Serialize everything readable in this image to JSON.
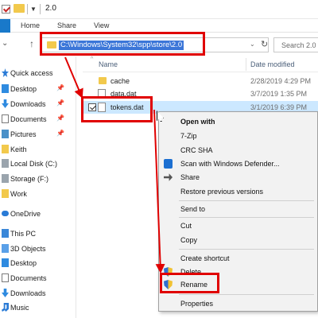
{
  "window": {
    "title": "2.0"
  },
  "ribbon": {
    "tabs": [
      "Home",
      "Share",
      "View"
    ]
  },
  "address": {
    "path": "C:\\Windows\\System32\\spp\\store\\2.0"
  },
  "search": {
    "placeholder": "Search 2.0"
  },
  "sidebar": {
    "items": [
      {
        "label": "Quick access",
        "icon": "star-icon"
      },
      {
        "label": "Desktop",
        "icon": "desktop-icon",
        "pinned": true
      },
      {
        "label": "Downloads",
        "icon": "downloads-icon",
        "pinned": true
      },
      {
        "label": "Documents",
        "icon": "documents-icon",
        "pinned": true
      },
      {
        "label": "Pictures",
        "icon": "pictures-icon",
        "pinned": true
      },
      {
        "label": "Keith",
        "icon": "folder-icon"
      },
      {
        "label": "Local Disk (C:)",
        "icon": "drive-icon"
      },
      {
        "label": "Storage (F:)",
        "icon": "drive-icon"
      },
      {
        "label": "Work",
        "icon": "folder-icon"
      },
      {
        "label": "OneDrive",
        "icon": "cloud-icon"
      },
      {
        "label": "This PC",
        "icon": "pc-icon"
      },
      {
        "label": "3D Objects",
        "icon": "3d-objects-icon"
      },
      {
        "label": "Desktop",
        "icon": "desktop-icon"
      },
      {
        "label": "Documents",
        "icon": "documents-icon"
      },
      {
        "label": "Downloads",
        "icon": "downloads-icon"
      },
      {
        "label": "Music",
        "icon": "music-icon"
      }
    ]
  },
  "columns": {
    "name": "Name",
    "date": "Date modified"
  },
  "files": [
    {
      "name": "cache",
      "date": "2/28/2019 4:29 PM",
      "type": "folder"
    },
    {
      "name": "data.dat",
      "date": "3/7/2019 1:35 PM",
      "type": "file"
    },
    {
      "name": "tokens.dat",
      "date": "3/1/2019 6:39 PM",
      "type": "file",
      "selected": true
    }
  ],
  "context_menu": {
    "items": [
      {
        "label": "Open with",
        "bold": true
      },
      {
        "label": "7-Zip"
      },
      {
        "label": "CRC SHA"
      },
      {
        "label": "Scan with Windows Defender..."
      },
      {
        "label": "Share"
      },
      {
        "label": "Restore previous versions"
      },
      {
        "label": "Send to"
      },
      {
        "label": "Cut"
      },
      {
        "label": "Copy"
      },
      {
        "label": "Create shortcut"
      },
      {
        "label": "Delete"
      },
      {
        "label": "Rename"
      },
      {
        "label": "Properties"
      }
    ]
  },
  "colors": {
    "highlight": "#e00000",
    "selection": "#cce8ff",
    "address_selection": "#3b76d8",
    "accent": "#1979ca"
  }
}
